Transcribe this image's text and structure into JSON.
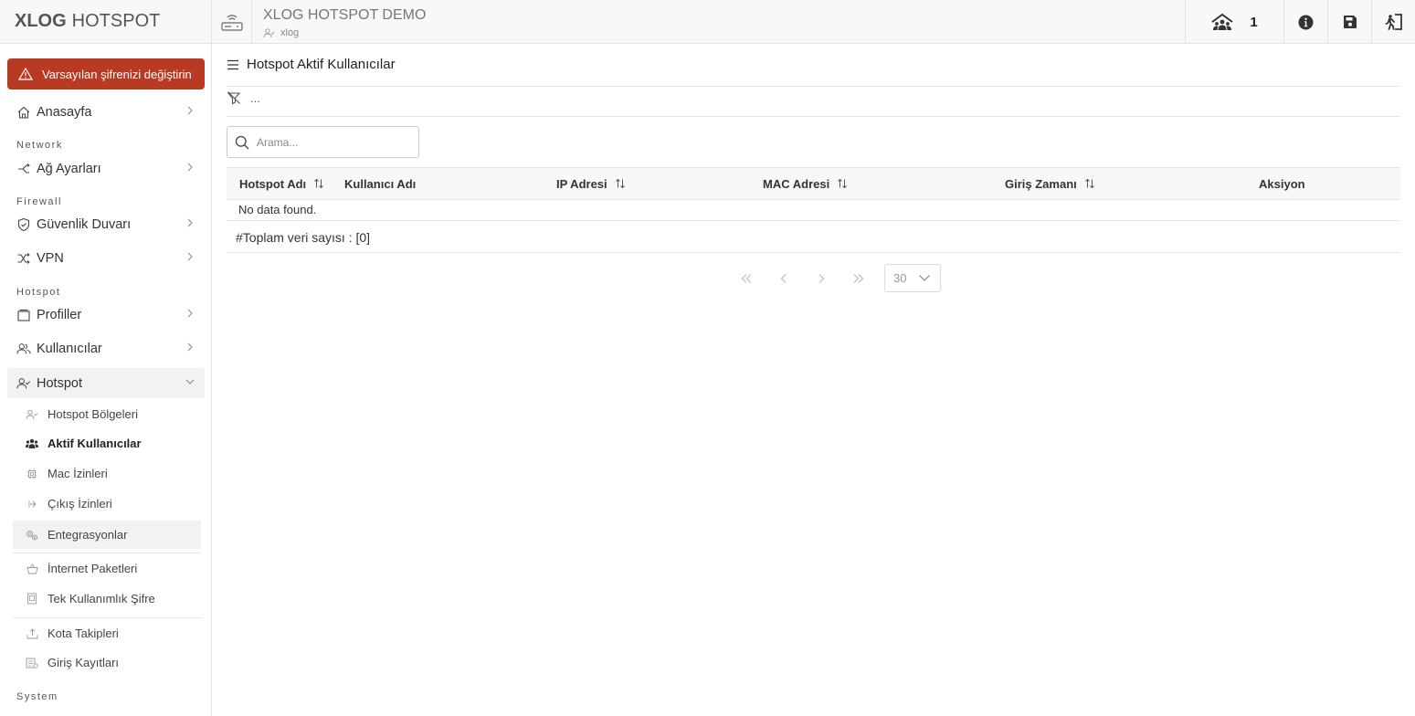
{
  "brand": {
    "bold": "XLOG",
    "rest": "HOTSPOT"
  },
  "warning": "Varsayılan şifrenizi değiştirin",
  "sidebar": {
    "home": "Anasayfa",
    "sections": {
      "network": "Network",
      "firewall": "Firewall",
      "hotspot": "Hotspot",
      "system": "System"
    },
    "network_settings": "Ağ Ayarları",
    "firewall": "Güvenlik Duvarı",
    "vpn": "VPN",
    "profiles": "Profiller",
    "users": "Kullanıcılar",
    "hotspot": "Hotspot",
    "hotspot_sub": [
      "Hotspot Bölgeleri",
      "Aktif Kullanıcılar",
      "Mac İzinleri",
      "Çıkış İzinleri",
      "Entegrasyonlar",
      "İnternet Paketleri",
      "Tek Kullanımlık Şifre",
      "Kota Takipleri",
      "Giriş Kayıtları"
    ]
  },
  "header": {
    "title": "XLOG HOTSPOT DEMO",
    "user": "xlog",
    "online_count": "1"
  },
  "page": {
    "title": "Hotspot Aktif Kullanıcılar",
    "filter": "...",
    "search_placeholder": "Arama...",
    "columns": [
      "Hotspot Adı",
      "Kullanıcı Adı",
      "IP Adresi",
      "MAC Adresi",
      "Giriş Zamanı",
      "Aksiyon"
    ],
    "empty": "No data found.",
    "total": "#Toplam veri sayısı : [0]",
    "page_size": "30"
  },
  "colors": {
    "warning_bg": "#b83a22",
    "border": "#e4e4e4"
  }
}
